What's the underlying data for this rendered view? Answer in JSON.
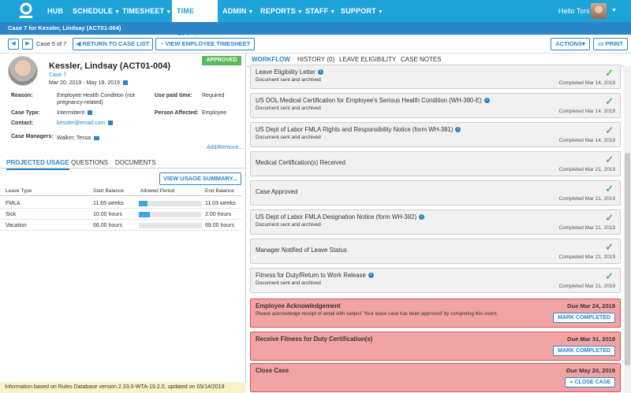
{
  "nav": {
    "items": [
      "HUB",
      "SCHEDULE",
      "TIMESHEET",
      "TIME OFF",
      "ADMIN",
      "REPORTS",
      "STAFF",
      "SUPPORT"
    ],
    "greeting": "Hello Toni"
  },
  "case_bar": "Case 7 for Kessler, Lindsay (ACT01-004)",
  "toolbar": {
    "case_count": "Case 5 of 7",
    "return_label": "RETURN TO CASE LIST",
    "timesheet_label": "VIEW EMPLOYEE TIMESHEET",
    "actions_label": "ACTIONS",
    "print_label": "PRINT"
  },
  "employee": {
    "name": "Kessler, Lindsay (ACT01-004)",
    "status": "APPROVED",
    "case_link": "Case 7",
    "dates": "Mar 20, 2019 - May 18, 2019",
    "reason_label": "Reason:",
    "reason_value": "Employee Health Condition (not pregnancy-related)",
    "paid_label": "Use paid time:",
    "paid_value": "Required",
    "case_type_label": "Case Type:",
    "case_type_value": "Intermittent",
    "person_label": "Person Affected:",
    "person_value": "Employee",
    "contact_label": "Contact:",
    "contact_value": "kessler@email.com",
    "managers_label": "Case Managers:",
    "managers_value": "Walker, Tessa",
    "add_remove": "Add/Remove..."
  },
  "left_tabs": [
    "PROJECTED USAGE",
    "QUESTIONS",
    "DOCUMENTS"
  ],
  "usage": {
    "summary_button": "VIEW USAGE SUMMARY...",
    "headers": [
      "Leave Type",
      "Start Balance",
      "Allowed Period",
      "End Balance"
    ],
    "rows": [
      {
        "type": "FMLA",
        "start": "11.65 weeks",
        "fill": 0.14,
        "end": "11.03 weeks"
      },
      {
        "type": "Sick",
        "start": "10.00 hours",
        "fill": 0.18,
        "end": "2.00 hours"
      },
      {
        "type": "Vacation",
        "start": "66.00 hours",
        "fill": 0.0,
        "end": "69.00 hours"
      }
    ]
  },
  "footer": "Information based on Rules Database version 2.33.0-WTA-19.2.0, updated on 05/14/2019",
  "right_tabs": [
    "WORKFLOW",
    "HISTORY (0)",
    "LEAVE ELIGIBILITY",
    "CASE NOTES"
  ],
  "workflow": [
    {
      "title": "Leave Eligibility Letter",
      "info": true,
      "sub": "Document sent and archived",
      "done": "Completed Mar 14, 2019"
    },
    {
      "title": "US DOL Medical Certification for Employee's Serious Health Condition (WH-380-E)",
      "info": true,
      "sub": "Document sent and archived",
      "done": "Completed Mar 14, 2019"
    },
    {
      "title": "US Dept of Labor FMLA Rights and Responsibility Notice (form WH-381)",
      "info": true,
      "sub": "Document sent and archived",
      "done": "Completed Mar 14, 2019"
    },
    {
      "title": "Medical Certification(s) Received",
      "info": false,
      "sub": "",
      "done": "Completed Mar 21, 2019"
    },
    {
      "title": "Case Approved",
      "info": false,
      "sub": "",
      "done": "Completed Mar 21, 2019"
    },
    {
      "title": "US Dept of Labor FMLA Designation Notice (form WH-382)",
      "info": true,
      "sub": "Document sent and archived",
      "done": "Completed Mar 21, 2019"
    },
    {
      "title": "Manager Notified of Leave Status",
      "info": false,
      "sub": "",
      "done": "Completed Mar 21, 2019"
    },
    {
      "title": "Fitness for Duty/Return to Work Release",
      "info": true,
      "sub": "Document sent and archived",
      "done": "Completed Mar 21, 2019"
    }
  ],
  "due_items": [
    {
      "title": "Employee Acknowledgement",
      "sub": "Please acknowledge receipt of email with subject 'Your leave case has been approved' by completing this event.",
      "due": "Due Mar 24, 2019",
      "button": "MARK COMPLETED"
    },
    {
      "title": "Receive Fitness for Duty Certification(s)",
      "sub": "",
      "due": "Due Mar 31, 2019",
      "button": "MARK COMPLETED"
    },
    {
      "title": "Close Case",
      "sub": "",
      "due": "Due May 20, 2019",
      "button": "CLOSE CASE"
    }
  ],
  "colors": {
    "nav": "#1ea3d8",
    "accent": "#2a86c9",
    "approved": "#5cb85c",
    "due_bg": "#f2a3a3"
  }
}
